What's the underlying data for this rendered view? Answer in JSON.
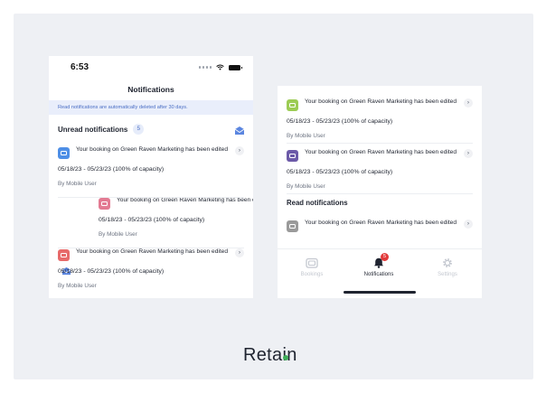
{
  "status_bar": {
    "time": "6:53"
  },
  "left_screen": {
    "title": "Notifications",
    "banner": "Read notifications are automatically deleted after 30 days.",
    "unread_section": {
      "title": "Unread notifications",
      "count": "5"
    },
    "items": [
      {
        "title": "Your booking on Green Raven Marketing has been edited",
        "dates": "05/18/23 - 05/23/23 (100% of capacity)",
        "author": "By Mobile User",
        "icon_color": "#4e8fe6"
      },
      {
        "title": "Your booking on Green Raven Marketing has been edited",
        "dates": "05/18/23 - 05/23/23 (100% of capacity)",
        "author": "By Mobile User",
        "icon_color": "#e37a92"
      },
      {
        "title": "Your booking on Green Raven Marketing has been edited",
        "dates": "05/18/23 - 05/23/23 (100% of capacity)",
        "author": "By Mobile User",
        "icon_color": "#e76a6a"
      }
    ]
  },
  "right_screen": {
    "unread_items": [
      {
        "title": "Your booking on Green Raven Marketing has been edited",
        "dates": "05/18/23 - 05/23/23 (100% of capacity)",
        "author": "By Mobile User",
        "icon_color": "#9ccc54"
      },
      {
        "title": "Your booking on Green Raven Marketing has been edited",
        "dates": "05/18/23 - 05/23/23 (100% of capacity)",
        "author": "By Mobile User",
        "icon_color": "#6c5aa8"
      }
    ],
    "read_section": {
      "title": "Read notifications"
    },
    "read_items": [
      {
        "title": "Your booking on Green Raven Marketing has been edited",
        "icon_color": "#9a9a9a"
      }
    ],
    "tab_bar": {
      "tabs": [
        {
          "label": "Bookings",
          "icon": "calendar-icon",
          "active": false
        },
        {
          "label": "Notifications",
          "icon": "bell-icon",
          "active": true,
          "badge": "5"
        },
        {
          "label": "Settings",
          "icon": "gear-icon",
          "active": false
        }
      ]
    }
  },
  "brand": {
    "logo_text": "Retain",
    "accent": "#3fae5a"
  }
}
